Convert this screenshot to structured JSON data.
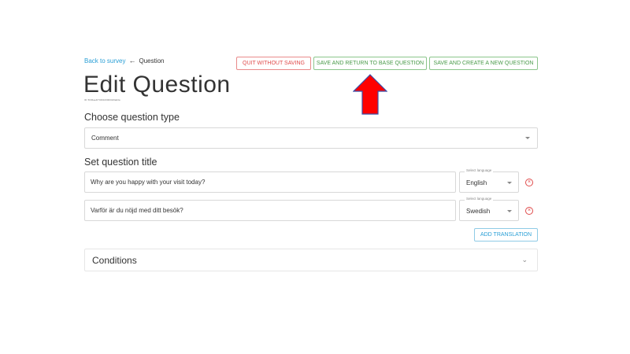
{
  "breadcrumb": {
    "back_link": "Back to survey",
    "arrow": "←",
    "current": "Question"
  },
  "page": {
    "title": "Edit Question",
    "id_text": "ID: 5f4f4ae4f7349100000426ab0a"
  },
  "actions": {
    "quit_label": "QUIT WITHOUT SAVING",
    "save_return_label": "SAVE AND RETURN TO BASE QUESTION",
    "save_new_label": "SAVE AND CREATE A NEW QUESTION"
  },
  "question_type": {
    "heading": "Choose question type",
    "selected": "Comment"
  },
  "question_title": {
    "heading": "Set question title",
    "translations": [
      {
        "text": "Why are you happy with your visit today?",
        "language_label": "Select language",
        "language": "English"
      },
      {
        "text": "Varför är du nöjd med ditt besök?",
        "language_label": "Select language",
        "language": "Swedish"
      }
    ],
    "add_translation_label": "ADD TRANSLATION"
  },
  "conditions": {
    "label": "Conditions"
  },
  "icons": {
    "back_arrow": "arrow-left-icon",
    "remove": "close-circle-icon",
    "dropdown": "chevron-down-icon",
    "annotation": "up-arrow-annotation-icon"
  },
  "colors": {
    "link": "#2a9fd6",
    "danger": "#e04b4b",
    "success": "#4a9a4a",
    "annotation_fill": "#ff0000",
    "annotation_stroke": "#3b4fa8"
  }
}
